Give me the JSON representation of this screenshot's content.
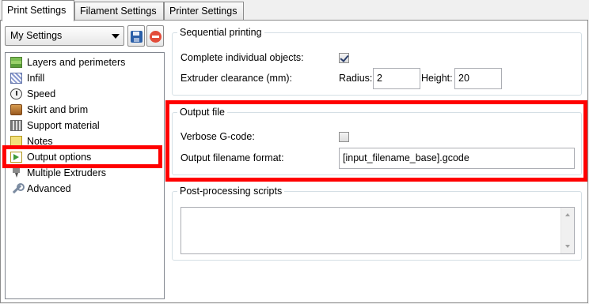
{
  "tabs": [
    {
      "label": "Print Settings",
      "active": true
    },
    {
      "label": "Filament Settings",
      "active": false
    },
    {
      "label": "Printer Settings",
      "active": false
    }
  ],
  "preset": {
    "selected": "My Settings",
    "save_icon": "save-icon",
    "delete_icon": "delete-icon"
  },
  "categories": [
    {
      "label": "Layers and perimeters",
      "icon": "layers-icon"
    },
    {
      "label": "Infill",
      "icon": "infill-icon"
    },
    {
      "label": "Speed",
      "icon": "speed-icon"
    },
    {
      "label": "Skirt and brim",
      "icon": "skirt-icon"
    },
    {
      "label": "Support material",
      "icon": "support-icon"
    },
    {
      "label": "Notes",
      "icon": "notes-icon"
    },
    {
      "label": "Output options",
      "icon": "output-icon",
      "selected": true
    },
    {
      "label": "Multiple Extruders",
      "icon": "extruder-icon"
    },
    {
      "label": "Advanced",
      "icon": "wrench-icon"
    }
  ],
  "sequential": {
    "title": "Sequential printing",
    "complete_label": "Complete individual objects:",
    "complete_checked": true,
    "clearance_label": "Extruder clearance (mm):",
    "radius_label": "Radius:",
    "radius_value": "2",
    "height_label": "Height:",
    "height_value": "20"
  },
  "output_file": {
    "title": "Output file",
    "verbose_label": "Verbose G-code:",
    "verbose_checked": false,
    "format_label": "Output filename format:",
    "format_value": "[input_filename_base].gcode"
  },
  "post_processing": {
    "title": "Post-processing scripts",
    "value": ""
  },
  "colors": {
    "highlight": "#ff0000",
    "tab_border": "#8c8c8c",
    "group_border": "#d5dfe5"
  }
}
